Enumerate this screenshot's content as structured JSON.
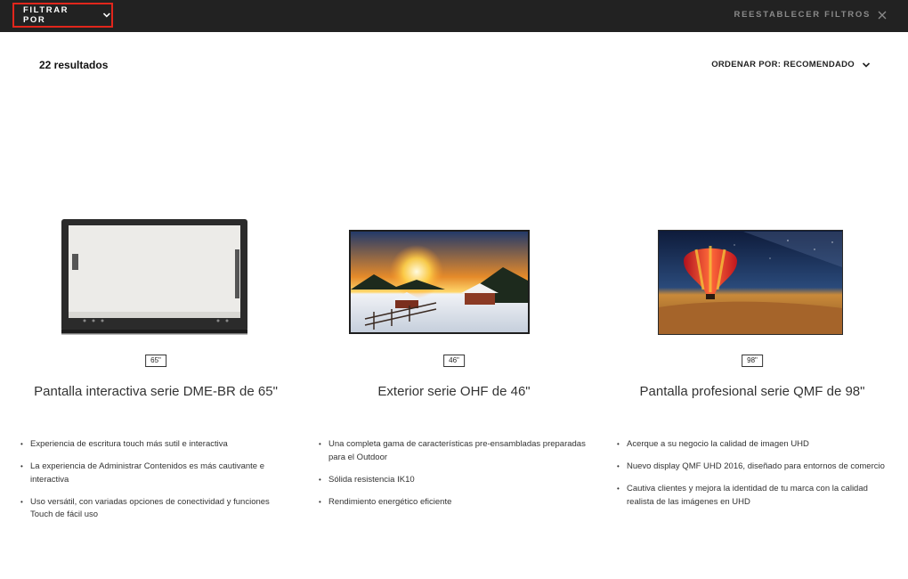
{
  "topbar": {
    "filter_label": "FILTRAR POR",
    "reset_label": "REESTABLECER FILTROS",
    "accent_color": "#e1261c"
  },
  "results": {
    "count_label": "22 resultados",
    "sort_label": "ORDENAR POR: RECOMENDADO"
  },
  "products": [
    {
      "size": "65\"",
      "title": "Pantalla interactiva serie DME-BR de 65\"",
      "features": [
        "Experiencia de escritura touch más sutil e interactiva",
        "La experiencia de Administrar Contenidos es más cautivante e interactiva",
        "Uso versátil, con variadas opciones de conectividad y funciones Touch de fácil uso"
      ]
    },
    {
      "size": "46\"",
      "title": "Exterior serie OHF de 46\"",
      "features": [
        "Una completa gama de características pre-ensambladas preparadas para el Outdoor",
        "Sólida resistencia IK10",
        "Rendimiento energético eficiente"
      ]
    },
    {
      "size": "98\"",
      "title": "Pantalla profesional serie QMF de 98\"",
      "features": [
        "Acerque a su negocio la calidad de imagen UHD",
        "Nuevo display QMF UHD 2016, diseñado para entornos de comercio",
        "Cautiva clientes y mejora la identidad de tu marca con la calidad realista de las imágenes en UHD"
      ]
    }
  ]
}
